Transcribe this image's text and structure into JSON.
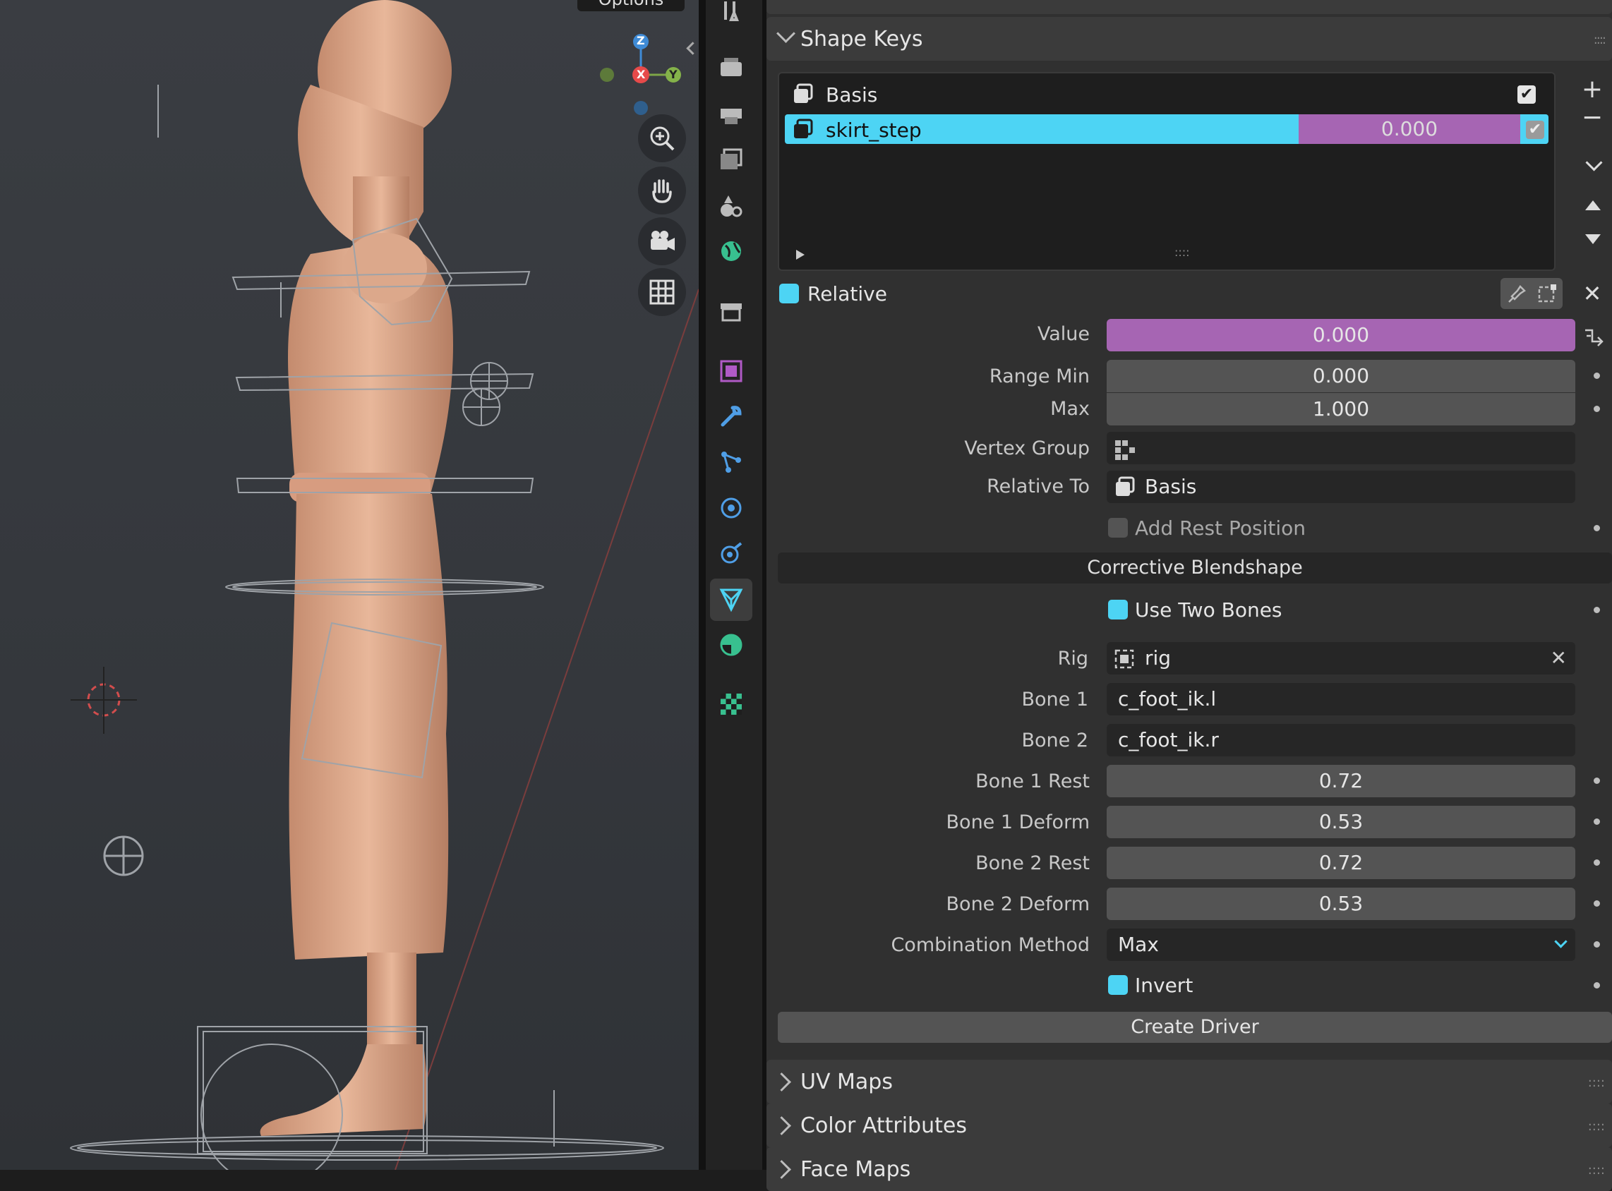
{
  "viewport": {
    "options_label": "Options",
    "gizmo": {
      "z": "Z",
      "x": "X",
      "y": "Y"
    },
    "tools": [
      "zoom-in-icon",
      "hand-pan-icon",
      "camera-icon",
      "grid-view-icon"
    ]
  },
  "tabs": [
    {
      "name": "tool-icon"
    },
    {
      "name": "render-icon"
    },
    {
      "name": "output-icon"
    },
    {
      "name": "view-layer-icon"
    },
    {
      "name": "scene-icon"
    },
    {
      "name": "world-icon"
    },
    {
      "name": "collection-icon"
    },
    {
      "name": "object-icon"
    },
    {
      "name": "modifier-icon"
    },
    {
      "name": "particles-icon"
    },
    {
      "name": "physics-icon"
    },
    {
      "name": "constraints-icon"
    },
    {
      "name": "object-data-icon",
      "active": true
    },
    {
      "name": "material-icon"
    },
    {
      "name": "texture-icon"
    }
  ],
  "shape_keys": {
    "title": "Shape Keys",
    "items": [
      {
        "name": "Basis",
        "checked": true
      },
      {
        "name": "skirt_step",
        "value": "0.000",
        "checked": true,
        "selected": true
      }
    ],
    "relative_label": "Relative",
    "value_label": "Value",
    "value": "0.000",
    "range_min_label": "Range Min",
    "range_min": "0.000",
    "max_label": "Max",
    "max": "1.000",
    "vertex_group_label": "Vertex Group",
    "vertex_group": "",
    "relative_to_label": "Relative To",
    "relative_to": "Basis",
    "add_rest_label": "Add Rest Position"
  },
  "corrective": {
    "title": "Corrective Blendshape",
    "use_two_bones_label": "Use Two Bones",
    "rig_label": "Rig",
    "rig": "rig",
    "bone1_label": "Bone 1",
    "bone1": "c_foot_ik.l",
    "bone2_label": "Bone 2",
    "bone2": "c_foot_ik.r",
    "bone1_rest_label": "Bone 1 Rest",
    "bone1_rest": "0.72",
    "bone1_deform_label": "Bone 1 Deform",
    "bone1_deform": "0.53",
    "bone2_rest_label": "Bone 2 Rest",
    "bone2_rest": "0.72",
    "bone2_deform_label": "Bone 2 Deform",
    "bone2_deform": "0.53",
    "combination_label": "Combination Method",
    "combination": "Max",
    "invert_label": "Invert",
    "create_driver_label": "Create Driver"
  },
  "collapsed_panels": [
    "UV Maps",
    "Color Attributes",
    "Face Maps"
  ],
  "colors": {
    "accent": "#4dd4f4",
    "value_purple": "#a665b3",
    "panel": "#303030"
  }
}
